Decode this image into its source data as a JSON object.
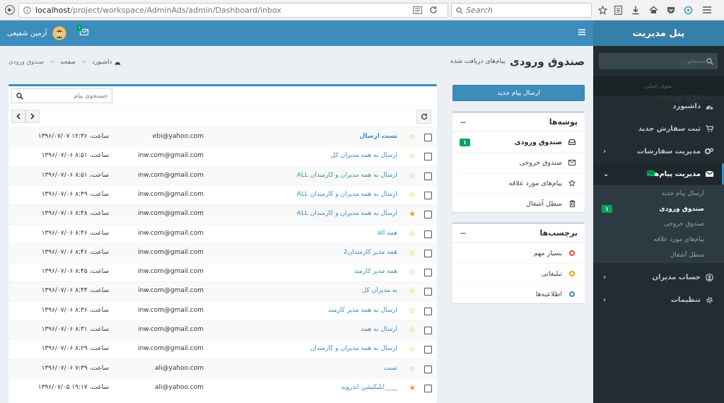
{
  "browser": {
    "url_host": "localhost",
    "url_path": "/project/workspace/AdminAds/admin/Dashboard/inbox",
    "search_placeholder": "Search"
  },
  "navbar": {
    "user_name": "آرمین شفیعی",
    "mail_badge": "۱"
  },
  "sidebar": {
    "title": "پنل مدیریت",
    "search_placeholder": "جستجو...",
    "header": "منوی اصلی",
    "items": [
      {
        "label": "داشبورد",
        "icon": "dashboard-icon"
      },
      {
        "label": "ثبت سفارش جدید",
        "icon": "cart-icon"
      },
      {
        "label": "مدیریت سفارشات",
        "icon": "cogs-icon"
      },
      {
        "label": "مدیریت پیام‌ها",
        "icon": "envelope-icon"
      },
      {
        "label": "حساب مدیران",
        "icon": "user-icon"
      },
      {
        "label": "تنظیمات",
        "icon": "gear-icon"
      }
    ],
    "sub_items": [
      {
        "label": "ارسال پیام جدید"
      },
      {
        "label": "صندوق ورودی",
        "badge": "۱"
      },
      {
        "label": "صندوق خروجی"
      },
      {
        "label": "پیام‌های مورد علاقه"
      },
      {
        "label": "سطل آشغال"
      }
    ]
  },
  "page": {
    "title": "صندوق ورودی",
    "subtitle": "پیام‌های دریافت شده",
    "breadcrumb": [
      "داشبورد",
      "صفحه",
      "صندوق ورودی"
    ]
  },
  "compose_label": "ارسال پیام جدید",
  "folders": {
    "title": "پوشه‌ها",
    "items": [
      {
        "label": "صندوق ورودی",
        "icon": "inbox-icon",
        "badge": "۱"
      },
      {
        "label": "صندوق خروجی",
        "icon": "envelope-o-icon"
      },
      {
        "label": "پیام‌های مورد علاقه",
        "icon": "star-o-icon"
      },
      {
        "label": "سطل آشغال",
        "icon": "trash-icon"
      }
    ]
  },
  "labels": {
    "title": "برچسب‌ها",
    "items": [
      {
        "label": "بسیار مهم",
        "color": "#dd4b39"
      },
      {
        "label": "تبلیغاتی",
        "color": "#f39c12"
      },
      {
        "label": "اطلاعیه‌ها",
        "color": "#3c8dbc"
      }
    ]
  },
  "mailbox": {
    "title": "صندوق ورودی",
    "search_placeholder": "جستجوی پیام",
    "star_color": "#f39c12",
    "messages": [
      {
        "subject": "تست ارسال",
        "sender": "ebi@yahoo.com",
        "date": "۱۳۹۶/۰۷/۰۷ ساعت، ۱۲:۳۶",
        "starred": false,
        "bold": true
      },
      {
        "subject": "ارسال به همه مدیران کل",
        "sender": "inw.com@gmail.com",
        "date": "۱۳۹۶/۰۷/۰۶ ساعت، ۸:۵۱",
        "starred": false
      },
      {
        "subject": "ارسال به همه مدیران و کارمندان ALL",
        "sender": "inw.com@gmail.com",
        "date": "۱۳۹۶/۰۷/۰۶ ساعت، ۸:۵۱",
        "starred": false
      },
      {
        "subject": "ارسال به همه مدیران و کارمندان ALL",
        "sender": "inw.com@gmail.com",
        "date": "۱۳۹۶/۰۷/۰۶ ساعت، ۸:۴۹",
        "starred": false
      },
      {
        "subject": "ارسال به همه مدیران و کارمندان ALL",
        "sender": "inw.com@gmail.com",
        "date": "۱۳۹۶/۰۷/۰۶ ساعت، ۸:۴۸",
        "starred": true
      },
      {
        "subject": "همه all",
        "sender": "inw.com@gmail.com",
        "date": "۱۳۹۶/۰۷/۰۶ ساعت، ۸:۴۶",
        "starred": false
      },
      {
        "subject": "همه مدیر کارمندان2",
        "sender": "inw.com@gmail.com",
        "date": "۱۳۹۶/۰۷/۰۶ ساعت، ۸:۴۶",
        "starred": false
      },
      {
        "subject": "همه مدیر کارمند",
        "sender": "inw.com@gmail.com",
        "date": "۱۳۹۶/۰۷/۰۶ ساعت، ۸:۴۵",
        "starred": false
      },
      {
        "subject": "به مدیران کل",
        "sender": "inw.com@gmail.com",
        "date": "۱۳۹۶/۰۷/۰۶ ساعت، ۸:۴۴",
        "starred": false
      },
      {
        "subject": "ارسال به همه مدیر کارمند",
        "sender": "inw.com@gmail.com",
        "date": "۱۳۹۶/۰۷/۰۶ ساعت، ۸:۳۶",
        "starred": false
      },
      {
        "subject": "ارسال به همه",
        "sender": "inw.com@gmail.com",
        "date": "۱۳۹۶/۰۷/۰۶ ساعت، ۸:۳۱",
        "starred": false
      },
      {
        "subject": "ارسال به همه مدیران و کارمندان",
        "sender": "inw.com@gmail.com",
        "date": "۱۳۹۶/۰۷/۰۶ ساعت، ۸:۲۹",
        "starred": false
      },
      {
        "subject": "تست",
        "sender": "ali@yahoo.com",
        "date": "۱۳۹۶/۰۷/۰۶ ساعت، ۷:۳۹",
        "starred": false
      },
      {
        "subject": "____ابلیکیشن اندروید",
        "sender": "ali@yahoo.com",
        "date": "۱۳۹۶/۰۷/۰۵ ساعت، ۱۹:۱۷",
        "starred": true
      }
    ]
  }
}
